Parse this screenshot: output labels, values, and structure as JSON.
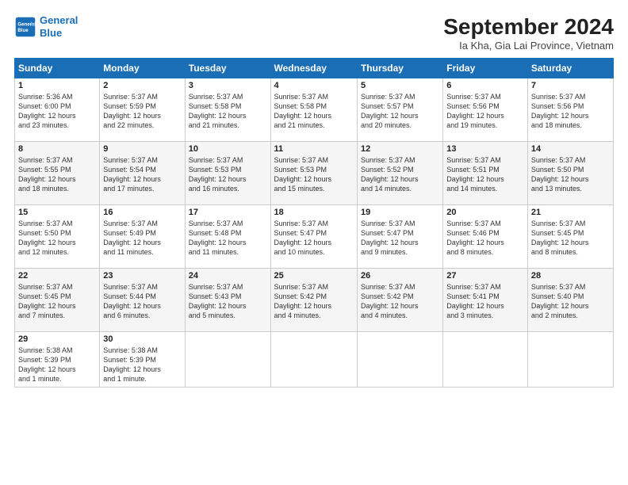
{
  "header": {
    "logo_line1": "General",
    "logo_line2": "Blue",
    "month_title": "September 2024",
    "location": "Ia Kha, Gia Lai Province, Vietnam"
  },
  "weekdays": [
    "Sunday",
    "Monday",
    "Tuesday",
    "Wednesday",
    "Thursday",
    "Friday",
    "Saturday"
  ],
  "weeks": [
    [
      {
        "day": "1",
        "info": "Sunrise: 5:36 AM\nSunset: 6:00 PM\nDaylight: 12 hours\nand 23 minutes."
      },
      {
        "day": "2",
        "info": "Sunrise: 5:37 AM\nSunset: 5:59 PM\nDaylight: 12 hours\nand 22 minutes."
      },
      {
        "day": "3",
        "info": "Sunrise: 5:37 AM\nSunset: 5:58 PM\nDaylight: 12 hours\nand 21 minutes."
      },
      {
        "day": "4",
        "info": "Sunrise: 5:37 AM\nSunset: 5:58 PM\nDaylight: 12 hours\nand 21 minutes."
      },
      {
        "day": "5",
        "info": "Sunrise: 5:37 AM\nSunset: 5:57 PM\nDaylight: 12 hours\nand 20 minutes."
      },
      {
        "day": "6",
        "info": "Sunrise: 5:37 AM\nSunset: 5:56 PM\nDaylight: 12 hours\nand 19 minutes."
      },
      {
        "day": "7",
        "info": "Sunrise: 5:37 AM\nSunset: 5:56 PM\nDaylight: 12 hours\nand 18 minutes."
      }
    ],
    [
      {
        "day": "8",
        "info": "Sunrise: 5:37 AM\nSunset: 5:55 PM\nDaylight: 12 hours\nand 18 minutes."
      },
      {
        "day": "9",
        "info": "Sunrise: 5:37 AM\nSunset: 5:54 PM\nDaylight: 12 hours\nand 17 minutes."
      },
      {
        "day": "10",
        "info": "Sunrise: 5:37 AM\nSunset: 5:53 PM\nDaylight: 12 hours\nand 16 minutes."
      },
      {
        "day": "11",
        "info": "Sunrise: 5:37 AM\nSunset: 5:53 PM\nDaylight: 12 hours\nand 15 minutes."
      },
      {
        "day": "12",
        "info": "Sunrise: 5:37 AM\nSunset: 5:52 PM\nDaylight: 12 hours\nand 14 minutes."
      },
      {
        "day": "13",
        "info": "Sunrise: 5:37 AM\nSunset: 5:51 PM\nDaylight: 12 hours\nand 14 minutes."
      },
      {
        "day": "14",
        "info": "Sunrise: 5:37 AM\nSunset: 5:50 PM\nDaylight: 12 hours\nand 13 minutes."
      }
    ],
    [
      {
        "day": "15",
        "info": "Sunrise: 5:37 AM\nSunset: 5:50 PM\nDaylight: 12 hours\nand 12 minutes."
      },
      {
        "day": "16",
        "info": "Sunrise: 5:37 AM\nSunset: 5:49 PM\nDaylight: 12 hours\nand 11 minutes."
      },
      {
        "day": "17",
        "info": "Sunrise: 5:37 AM\nSunset: 5:48 PM\nDaylight: 12 hours\nand 11 minutes."
      },
      {
        "day": "18",
        "info": "Sunrise: 5:37 AM\nSunset: 5:47 PM\nDaylight: 12 hours\nand 10 minutes."
      },
      {
        "day": "19",
        "info": "Sunrise: 5:37 AM\nSunset: 5:47 PM\nDaylight: 12 hours\nand 9 minutes."
      },
      {
        "day": "20",
        "info": "Sunrise: 5:37 AM\nSunset: 5:46 PM\nDaylight: 12 hours\nand 8 minutes."
      },
      {
        "day": "21",
        "info": "Sunrise: 5:37 AM\nSunset: 5:45 PM\nDaylight: 12 hours\nand 8 minutes."
      }
    ],
    [
      {
        "day": "22",
        "info": "Sunrise: 5:37 AM\nSunset: 5:45 PM\nDaylight: 12 hours\nand 7 minutes."
      },
      {
        "day": "23",
        "info": "Sunrise: 5:37 AM\nSunset: 5:44 PM\nDaylight: 12 hours\nand 6 minutes."
      },
      {
        "day": "24",
        "info": "Sunrise: 5:37 AM\nSunset: 5:43 PM\nDaylight: 12 hours\nand 5 minutes."
      },
      {
        "day": "25",
        "info": "Sunrise: 5:37 AM\nSunset: 5:42 PM\nDaylight: 12 hours\nand 4 minutes."
      },
      {
        "day": "26",
        "info": "Sunrise: 5:37 AM\nSunset: 5:42 PM\nDaylight: 12 hours\nand 4 minutes."
      },
      {
        "day": "27",
        "info": "Sunrise: 5:37 AM\nSunset: 5:41 PM\nDaylight: 12 hours\nand 3 minutes."
      },
      {
        "day": "28",
        "info": "Sunrise: 5:37 AM\nSunset: 5:40 PM\nDaylight: 12 hours\nand 2 minutes."
      }
    ],
    [
      {
        "day": "29",
        "info": "Sunrise: 5:38 AM\nSunset: 5:39 PM\nDaylight: 12 hours\nand 1 minute."
      },
      {
        "day": "30",
        "info": "Sunrise: 5:38 AM\nSunset: 5:39 PM\nDaylight: 12 hours\nand 1 minute."
      },
      {
        "day": "",
        "info": ""
      },
      {
        "day": "",
        "info": ""
      },
      {
        "day": "",
        "info": ""
      },
      {
        "day": "",
        "info": ""
      },
      {
        "day": "",
        "info": ""
      }
    ]
  ]
}
